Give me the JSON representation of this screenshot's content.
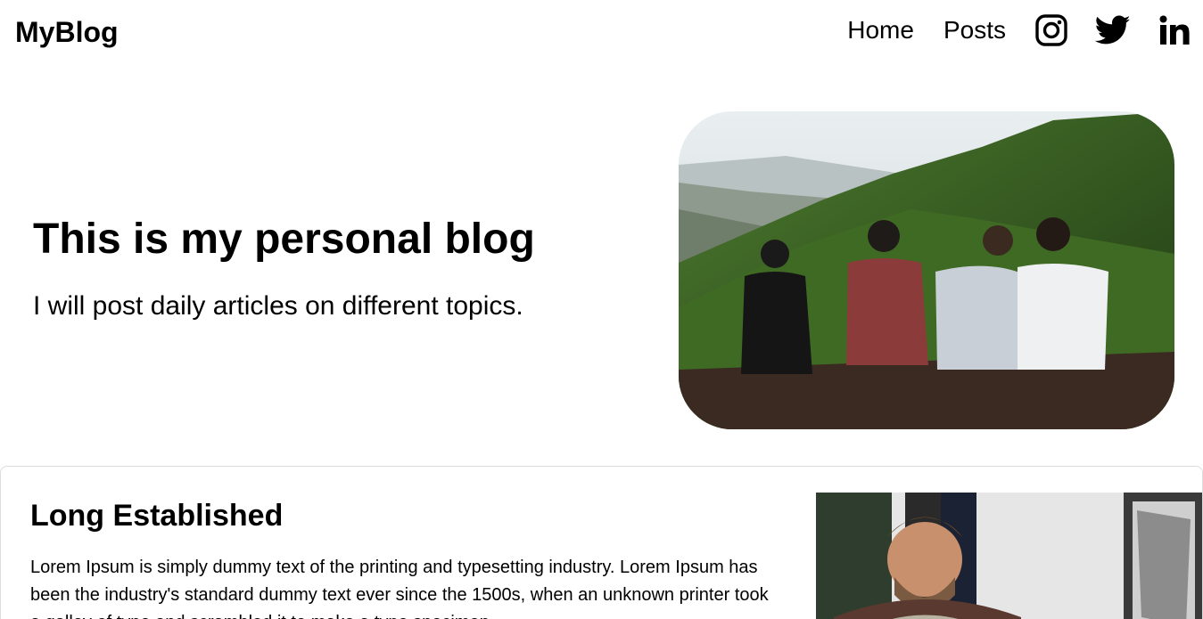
{
  "header": {
    "logo": "MyBlog",
    "nav": [
      {
        "label": "Home"
      },
      {
        "label": "Posts"
      }
    ],
    "social": [
      {
        "icon": "instagram-icon"
      },
      {
        "icon": "twitter-icon"
      },
      {
        "icon": "linkedin-icon"
      }
    ]
  },
  "hero": {
    "title": "This is my personal blog",
    "subtitle": "I will post daily articles on different topics.",
    "image": "four-friends-sitting-on-green-mountain-photo"
  },
  "posts": [
    {
      "title": "Long Established",
      "body": "Lorem Ipsum is simply dummy text of the printing and typesetting industry. Lorem Ipsum has been the industry's standard dummy text ever since the 1500s, when an unknown printer took a galley of type and scrambled it to make a type specimen",
      "image": "smiling-bearded-man-photo"
    }
  ],
  "colors": {
    "text": "#000000",
    "background": "#ffffff",
    "card_border": "#dcdcdc"
  }
}
